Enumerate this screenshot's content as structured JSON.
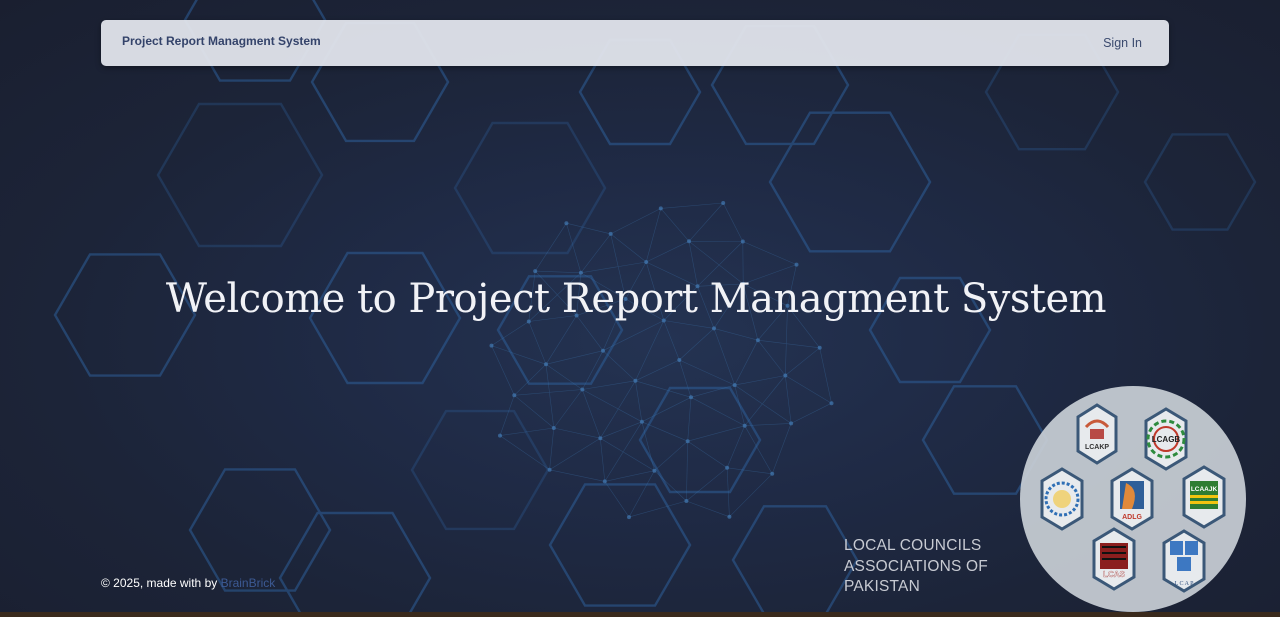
{
  "navbar": {
    "brand": "Project Report Managment System",
    "sign_in_label": "Sign In"
  },
  "hero": {
    "title": "Welcome to Project Report Managment System"
  },
  "footer": {
    "copyright": "© 2025, made with by ",
    "link_label": "BrainBrick"
  },
  "associations": {
    "lines": [
      "LOCAL COUNCILS",
      "ASSOCIATIONS OF",
      "PAKISTAN"
    ],
    "members": [
      "LCAKP",
      "LCAGB",
      "LCAS",
      "ADLG",
      "LCAAJK",
      "LCAS",
      "L C A P"
    ]
  },
  "colors": {
    "background": "#1c2438",
    "navbar": "#e2e5ec",
    "hex_lines": "#2f5f99",
    "accent_link": "#3c5a94"
  }
}
